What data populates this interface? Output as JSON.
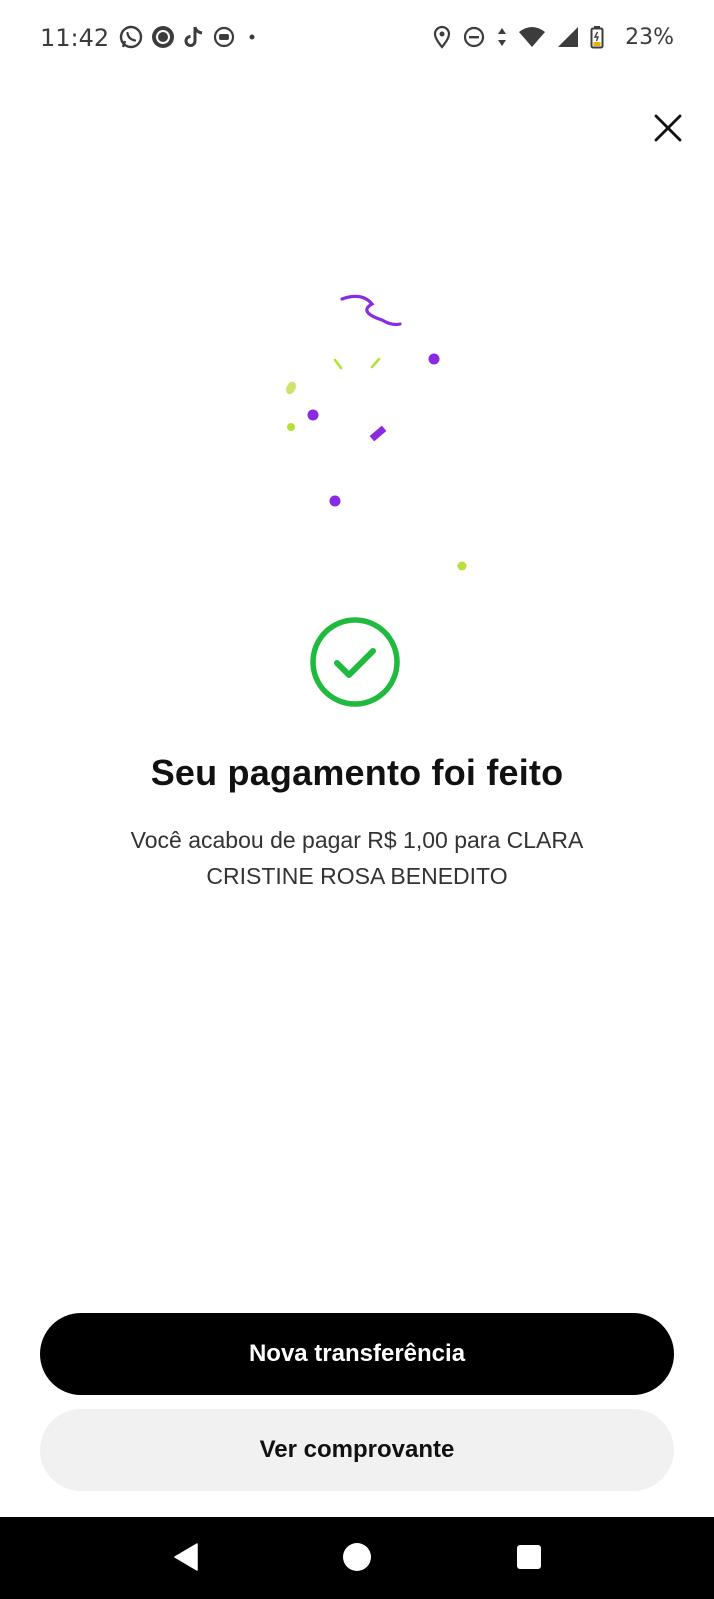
{
  "status_bar": {
    "time": "11:42",
    "battery_percent": "23%",
    "left_icons": [
      "whatsapp-icon",
      "circle-app-icon",
      "tiktok-icon",
      "media-icon",
      "more-dot-icon"
    ],
    "right_icons": [
      "location-icon",
      "do-not-disturb-icon",
      "data-arrows-icon",
      "wifi-icon",
      "signal-icon",
      "battery-icon"
    ]
  },
  "header": {
    "close_icon": "close-icon"
  },
  "success": {
    "title": "Seu pagamento foi feito",
    "message": "Você acabou de pagar R$ 1,00 para CLARA CRISTINE ROSA BENEDITO",
    "icon": "check-circle-icon"
  },
  "actions": {
    "primary_label": "Nova transferência",
    "secondary_label": "Ver comprovante"
  },
  "navigation": {
    "back_icon": "back-icon",
    "home_icon": "home-icon",
    "recents_icon": "recents-icon"
  },
  "colors": {
    "accent_purple": "#8a2be2",
    "accent_lime": "#b6e03c",
    "success_green": "#1fba3e",
    "primary_button": "#000000",
    "secondary_button": "#f1f1f1"
  }
}
